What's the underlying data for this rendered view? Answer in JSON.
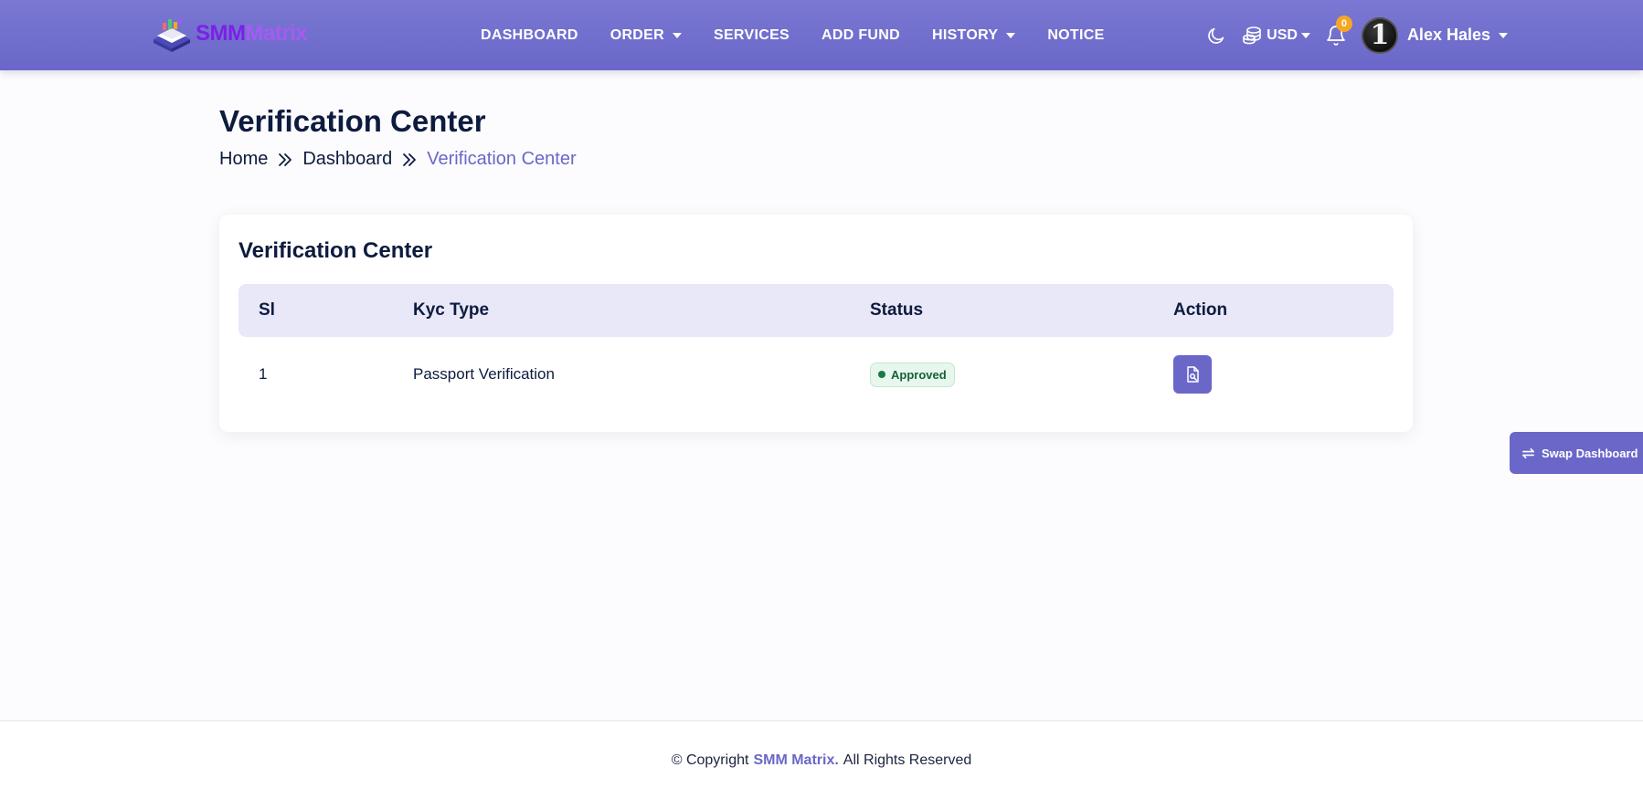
{
  "header": {
    "brand": {
      "part1": "SMM",
      "part2": "Matrix"
    },
    "nav": [
      {
        "label": "DASHBOARD",
        "dropdown": false
      },
      {
        "label": "ORDER",
        "dropdown": true
      },
      {
        "label": "SERVICES",
        "dropdown": false
      },
      {
        "label": "ADD FUND",
        "dropdown": false
      },
      {
        "label": "HISTORY",
        "dropdown": true
      },
      {
        "label": "NOTICE",
        "dropdown": false
      }
    ],
    "currency": "USD",
    "notification_count": "0",
    "avatar_text": "1",
    "username": "Alex Hales"
  },
  "page": {
    "title": "Verification Center",
    "breadcrumb": [
      "Home",
      "Dashboard",
      "Verification Center"
    ]
  },
  "card": {
    "title": "Verification Center",
    "columns": [
      "Sl",
      "Kyc Type",
      "Status",
      "Action"
    ],
    "rows": [
      {
        "sl": "1",
        "kyc_type": "Passport Verification",
        "status": "Approved"
      }
    ]
  },
  "swap_button": "Swap Dashboard",
  "footer": {
    "prefix": "© Copyright",
    "brand": "SMM Matrix.",
    "suffix": "All Rights Reserved"
  },
  "colors": {
    "primary": "#6a67c9",
    "header_gradient_top": "#7a78d2",
    "status_success": "#1a7a45",
    "badge": "#f5a623",
    "heading_text": "#0d1b3e"
  },
  "icons": {
    "theme_toggle": "moon-icon",
    "currency": "coins-icon",
    "notifications": "bell-icon",
    "breadcrumb_separator": "double-chevron-right-icon",
    "action": "document-view-icon",
    "swap": "swap-arrows-icon"
  }
}
